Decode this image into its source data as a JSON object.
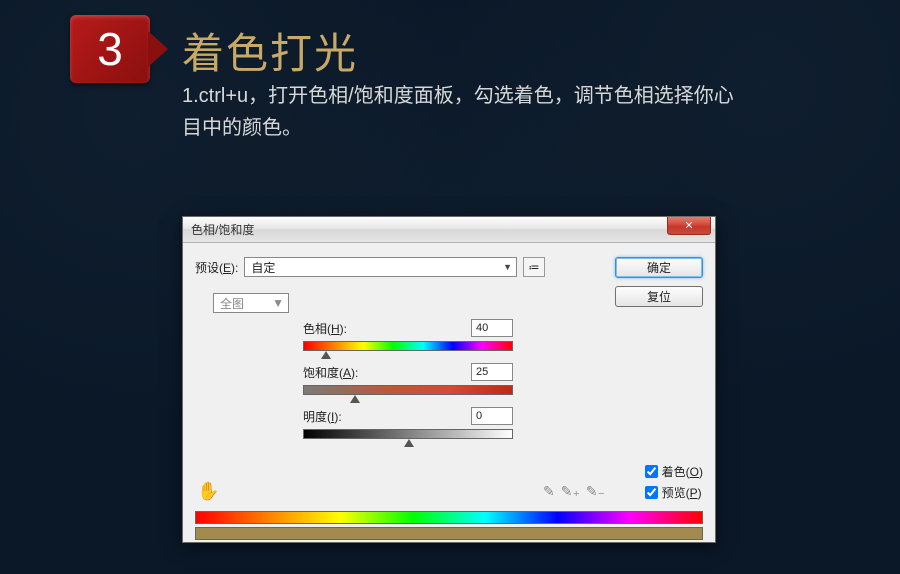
{
  "step": {
    "number": "3",
    "title": "着色打光"
  },
  "description": "1.ctrl+u，打开色相/饱和度面板，勾选着色，调节色相选择你心目中的颜色。",
  "dialog": {
    "title": "色相/饱和度",
    "preset_label": "预设(E):",
    "preset_value": "自定",
    "ok": "确定",
    "reset": "复位",
    "channel": "全图",
    "hue_label": "色相(H):",
    "hue_value": "40",
    "sat_label": "饱和度(A):",
    "sat_value": "25",
    "light_label": "明度(I):",
    "light_value": "0",
    "colorize": "着色(O)",
    "preview": "预览(P)"
  }
}
